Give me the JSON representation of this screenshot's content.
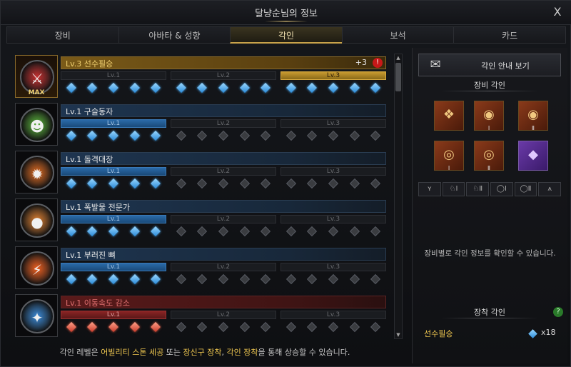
{
  "window": {
    "title": "달냥순님의 정보",
    "close_glyph": "X"
  },
  "tabs": [
    {
      "label": "장비",
      "active": false
    },
    {
      "label": "아바타 & 성향",
      "active": false
    },
    {
      "label": "각인",
      "active": true
    },
    {
      "label": "보석",
      "active": false
    },
    {
      "label": "카드",
      "active": false
    }
  ],
  "engravings": [
    {
      "title": "Lv.3 선수필승",
      "bonus": "+3",
      "warn": "!",
      "max_label": "MAX",
      "style": "gold",
      "icon": "knight-icon",
      "glyph": "⚔",
      "icon_color": "#c83030",
      "segs": [
        {
          "label": "Lv.1",
          "fill": "none"
        },
        {
          "label": "Lv.2",
          "fill": "none"
        },
        {
          "label": "Lv.3",
          "fill": "gold"
        }
      ],
      "gems": [
        [
          1,
          1,
          1,
          1,
          1
        ],
        [
          1,
          1,
          1,
          1,
          1
        ],
        [
          1,
          1,
          1,
          1,
          1
        ]
      ],
      "gem_color": "blue"
    },
    {
      "title": "Lv.1 구슬동자",
      "style": "blue",
      "icon": "orb-boy-icon",
      "glyph": "☻",
      "icon_color": "#5ab83a",
      "segs": [
        {
          "label": "Lv.1",
          "fill": "blue"
        },
        {
          "label": "Lv.2",
          "fill": "none"
        },
        {
          "label": "Lv.3",
          "fill": "none"
        }
      ],
      "gems": [
        [
          1,
          1,
          1,
          1,
          1
        ],
        [
          0,
          0,
          0,
          0,
          0
        ],
        [
          0,
          0,
          0,
          0,
          0
        ]
      ],
      "gem_color": "blue"
    },
    {
      "title": "Lv.1 돌격대장",
      "style": "blue",
      "icon": "charge-icon",
      "glyph": "✹",
      "icon_color": "#e06a20",
      "segs": [
        {
          "label": "Lv.1",
          "fill": "blue"
        },
        {
          "label": "Lv.2",
          "fill": "none"
        },
        {
          "label": "Lv.3",
          "fill": "none"
        }
      ],
      "gems": [
        [
          1,
          1,
          1,
          1,
          1
        ],
        [
          0,
          0,
          0,
          0,
          0
        ],
        [
          0,
          0,
          0,
          0,
          0
        ]
      ],
      "gem_color": "blue"
    },
    {
      "title": "Lv.1 폭발물 전문가",
      "style": "blue",
      "icon": "bomb-icon",
      "glyph": "●",
      "icon_color": "#e08030",
      "segs": [
        {
          "label": "Lv.1",
          "fill": "blue"
        },
        {
          "label": "Lv.2",
          "fill": "none"
        },
        {
          "label": "Lv.3",
          "fill": "none"
        }
      ],
      "gems": [
        [
          1,
          1,
          1,
          1,
          1
        ],
        [
          0,
          0,
          0,
          0,
          0
        ],
        [
          0,
          0,
          0,
          0,
          0
        ]
      ],
      "gem_color": "blue"
    },
    {
      "title": "Lv.1 부러진 뼈",
      "style": "blue",
      "icon": "broken-bone-icon",
      "glyph": "⚡",
      "icon_color": "#f06020",
      "segs": [
        {
          "label": "Lv.1",
          "fill": "blue"
        },
        {
          "label": "Lv.2",
          "fill": "none"
        },
        {
          "label": "Lv.3",
          "fill": "none"
        }
      ],
      "gems": [
        [
          1,
          1,
          1,
          1,
          1
        ],
        [
          0,
          0,
          0,
          0,
          0
        ],
        [
          0,
          0,
          0,
          0,
          0
        ]
      ],
      "gem_color": "blue"
    },
    {
      "title": "Lv.1 이동속도 감소",
      "style": "red",
      "icon": "slow-boot-icon",
      "glyph": "✦",
      "icon_color": "#3a8ad8",
      "segs": [
        {
          "label": "Lv.1",
          "fill": "red"
        },
        {
          "label": "Lv.2",
          "fill": "none"
        },
        {
          "label": "Lv.3",
          "fill": "none"
        }
      ],
      "gems": [
        [
          1,
          1,
          1,
          1,
          1
        ],
        [
          0,
          0,
          0,
          0,
          0
        ],
        [
          0,
          0,
          0,
          0,
          0
        ]
      ],
      "gem_color": "red"
    }
  ],
  "footer": {
    "prefix": "각인 레벨은 ",
    "h1": "어빌리티 스톤 세공",
    "mid1": " 또는 ",
    "h2": "장신구 장착",
    "mid2": ", ",
    "h3": "각인 장착",
    "suffix": "을 통해 상승할 수 있습니다."
  },
  "right": {
    "guide_label": "각인 안내 보기",
    "guide_icon": "✉",
    "equip_title": "장비 각인",
    "equipment": [
      {
        "name": "necklace-slot",
        "glyph": "❖",
        "numeral": ""
      },
      {
        "name": "earring-1-slot",
        "glyph": "◉",
        "numeral": "Ⅰ"
      },
      {
        "name": "earring-2-slot",
        "glyph": "◉",
        "numeral": "Ⅱ"
      },
      {
        "name": "ring-1-slot",
        "glyph": "◎",
        "numeral": "Ⅰ"
      },
      {
        "name": "ring-2-slot",
        "glyph": "◎",
        "numeral": "Ⅱ"
      },
      {
        "name": "ability-stone-slot",
        "glyph": "◆",
        "numeral": ""
      }
    ],
    "filters": [
      {
        "name": "filter-necklace",
        "label": "ʏ"
      },
      {
        "name": "filter-earring-1",
        "label": "♘Ⅰ"
      },
      {
        "name": "filter-earring-2",
        "label": "♘Ⅱ"
      },
      {
        "name": "filter-ring-1",
        "label": "◯Ⅰ"
      },
      {
        "name": "filter-ring-2",
        "label": "◯Ⅱ"
      },
      {
        "name": "filter-stone",
        "label": "⩚"
      }
    ],
    "info_text": "장비별로 각인 정보를 확인할 수 있습니다.",
    "applied_title": "장착 각인",
    "help_glyph": "?",
    "applied": [
      {
        "name": "선수필승",
        "count": "x18"
      }
    ]
  }
}
